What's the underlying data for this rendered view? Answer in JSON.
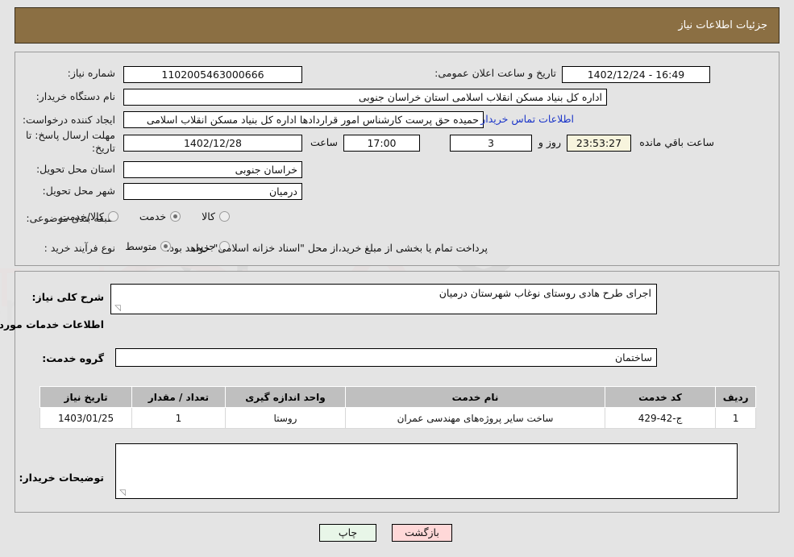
{
  "header": {
    "title": "جزئیات اطلاعات نیاز"
  },
  "form": {
    "need_number_label": "شماره نیاز:",
    "need_number_value": "1102005463000666",
    "announce_label": "تاریخ و ساعت اعلان عمومی:",
    "announce_value": "16:49 - 1402/12/24",
    "buyer_org_label": "نام دستگاه خریدار:",
    "buyer_org_value": "اداره کل بنیاد مسکن انقلاب اسلامی استان خراسان جنوبی",
    "requester_label": "ایجاد کننده درخواست:",
    "requester_value": "حمیده حق پرست کارشناس امور قراردادها اداره کل بنیاد مسکن انقلاب اسلامی",
    "contact_link": "اطلاعات تماس خریدار",
    "deadline_label": "مهلت ارسال پاسخ: تا تاریخ:",
    "deadline_date": "1402/12/28",
    "hour_label": "ساعت",
    "deadline_time": "17:00",
    "days_value": "3",
    "days_label": "روز و",
    "countdown_value": "23:53:27",
    "countdown_label": "ساعت باقي مانده",
    "province_label": "استان محل تحویل:",
    "province_value": "خراسان جنوبی",
    "city_label": "شهر محل تحویل:",
    "city_value": "درمیان",
    "category_label": "طبقه بندی موضوعی:",
    "category_options": [
      {
        "label": "کالا",
        "selected": false
      },
      {
        "label": "خدمت",
        "selected": true
      },
      {
        "label": "کالا/خدمت",
        "selected": false
      }
    ],
    "process_label": "نوع فرآیند خرید :",
    "process_options": [
      {
        "label": "جزیی",
        "selected": false
      },
      {
        "label": "متوسط",
        "selected": true
      }
    ],
    "payment_note": "پرداخت تمام یا بخشی از مبلغ خرید،از محل \"اسناد خزانه اسلامی\" خواهد بود."
  },
  "details": {
    "general_desc_label": "شرح کلی نیاز:",
    "general_desc_value": "اجرای طرح هادی روستای نوغاب شهرستان درمیان",
    "services_section_title": "اطلاعات خدمات مورد نیاز",
    "service_group_label": "گروه خدمت:",
    "service_group_value": "ساختمان",
    "buyer_notes_label": "توضیحات خریدار:",
    "buyer_notes_value": ""
  },
  "table": {
    "columns": [
      "ردیف",
      "کد خدمت",
      "نام خدمت",
      "واحد اندازه گیری",
      "تعداد / مقدار",
      "تاریخ نیاز"
    ],
    "rows": [
      [
        "1",
        "ج-42-429",
        "ساخت سایر پروژه‌های مهندسی عمران",
        "روستا",
        "1",
        "1403/01/25"
      ]
    ]
  },
  "footer": {
    "print_label": "چاپ",
    "back_label": "بازگشت"
  },
  "colors": {
    "header_bg": "#8b6f43",
    "page_bg": "#e4e4e4",
    "link": "#1b35c9",
    "table_header_bg": "#bfbfbf",
    "print_bg": "#e8f6e8",
    "back_bg": "#ffd8d8",
    "countdown_bg": "#f7f4dd"
  },
  "watermark": {
    "text": "AriaTender.net"
  }
}
